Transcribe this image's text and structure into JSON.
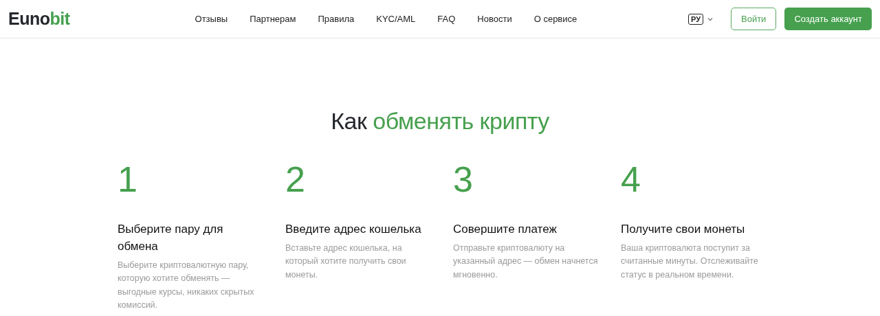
{
  "logo": {
    "main": "Euno",
    "accent": "bit"
  },
  "nav": [
    "Отзывы",
    "Партнерам",
    "Правила",
    "KYC/AML",
    "FAQ",
    "Новости",
    "О сервисе"
  ],
  "language": {
    "label": "РУ"
  },
  "buttons": {
    "login": "Войти",
    "signup": "Создать аккаунт"
  },
  "section": {
    "title_plain": "Как",
    "title_accent": "обменять крипту"
  },
  "steps": [
    {
      "number": "1",
      "title": "Выберите пару для обмена",
      "text": "Выберите криптовалютную пару, которую хотите обменять — выгодные курсы, никаких скрытых комиссий."
    },
    {
      "number": "2",
      "title": "Введите адрес кошелька",
      "text": "Вставьте адрес кошелька, на который хотите получить свои монеты."
    },
    {
      "number": "3",
      "title": "Совершите платеж",
      "text": "Отправьте криптовалюту на указанный адрес — обмен начнется мгновенно."
    },
    {
      "number": "4",
      "title": "Получите свои монеты",
      "text": "Ваша криптовалюта поступит за считанные минуты. Отслеживайте статус в реальном времени."
    }
  ]
}
